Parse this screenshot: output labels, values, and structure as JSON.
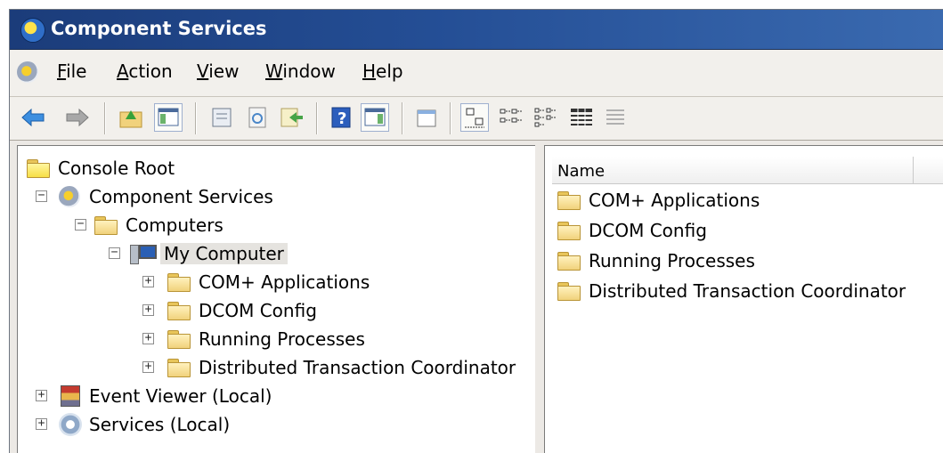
{
  "window": {
    "title": "Component Services"
  },
  "menu": {
    "items": [
      "File",
      "Action",
      "View",
      "Window",
      "Help"
    ]
  },
  "toolbar": {
    "buttons": [
      "back-arrow-icon",
      "forward-arrow-icon",
      "up-folder-icon",
      "show-hide-tree-icon",
      "properties-icon",
      "refresh-icon",
      "export-list-icon",
      "help-icon",
      "show-action-pane-icon",
      "new-window-icon",
      "large-icons-view-icon",
      "small-icons-view-icon",
      "list-view-icon",
      "detail-view-icon",
      "status-view-icon"
    ]
  },
  "tree": {
    "root": "Console Root",
    "component_services": "Component Services",
    "computers": "Computers",
    "my_computer": "My Computer",
    "children": [
      "COM+ Applications",
      "DCOM Config",
      "Running Processes",
      "Distributed Transaction Coordinator"
    ],
    "event_viewer": "Event Viewer (Local)",
    "services": "Services (Local)"
  },
  "list": {
    "column_header": "Name",
    "items": [
      "COM+ Applications",
      "DCOM Config",
      "Running Processes",
      "Distributed Transaction Coordinator"
    ]
  }
}
